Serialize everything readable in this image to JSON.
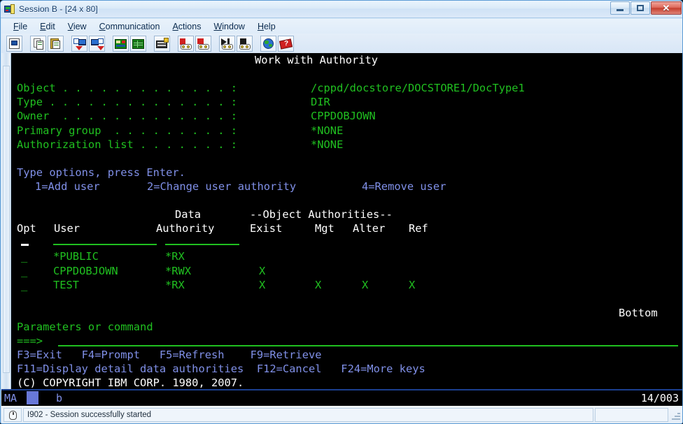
{
  "window": {
    "title": "Session B - [24 x 80]",
    "icon": "session-icon",
    "buttons": {
      "minimize": "minimize-button",
      "maximize": "maximize-button",
      "close": "✕"
    }
  },
  "menubar": {
    "items": [
      {
        "label": "File",
        "acc": "F",
        "rest": "ile"
      },
      {
        "label": "Edit",
        "acc": "E",
        "rest": "dit"
      },
      {
        "label": "View",
        "acc": "V",
        "rest": "iew"
      },
      {
        "label": "Communication",
        "acc": "C",
        "rest": "ommunication"
      },
      {
        "label": "Actions",
        "acc": "A",
        "rest": "ctions"
      },
      {
        "label": "Window",
        "acc": "W",
        "rest": "indow"
      },
      {
        "label": "Help",
        "acc": "H",
        "rest": "elp"
      }
    ]
  },
  "toolbar": {
    "buttons": [
      "display-session-icon",
      "copy-icon",
      "paste-icon",
      "send-file-icon",
      "receive-file-icon",
      "display-keypad-icon",
      "spreadsheet-icon",
      "keyboard-remap-icon",
      "record-macro-icon",
      "stop-macro-icon",
      "play-macro-icon",
      "stop-playback-icon",
      "globe-icon",
      "help-index-icon"
    ]
  },
  "terminal": {
    "screen_title": "Work with Authority",
    "fields": [
      {
        "label": "Object . . . . . . . . . . . . . :",
        "value": "/cppd/docstore/DOCSTORE1/DocType1"
      },
      {
        "label": "Type . . . . . . . . . . . . . . :",
        "value": "DIR"
      },
      {
        "label": "Owner  . . . . . . . . . . . . . :",
        "value": "CPPDOBJOWN"
      },
      {
        "label": "Primary group  . . . . . . . . . :",
        "value": "*NONE"
      },
      {
        "label": "Authorization list . . . . . . . :",
        "value": "*NONE"
      }
    ],
    "instructions": {
      "line1": "Type options, press Enter.",
      "options": [
        "1=Add user",
        "2=Change user authority",
        "4=Remove user"
      ]
    },
    "table": {
      "header_top": {
        "data": "Data",
        "object_auth": "--Object Authorities--"
      },
      "header_bottom": {
        "opt": "Opt",
        "user": "User",
        "authority": "Authority",
        "exist": "Exist",
        "mgt": "Mgt",
        "alter": "Alter",
        "ref": "Ref"
      },
      "rows": [
        {
          "opt": "_",
          "user": "*PUBLIC",
          "authority": "*RX",
          "exist": "",
          "mgt": "",
          "alter": "",
          "ref": ""
        },
        {
          "opt": "_",
          "user": "CPPDOBJOWN",
          "authority": "*RWX",
          "exist": "X",
          "mgt": "",
          "alter": "",
          "ref": ""
        },
        {
          "opt": "_",
          "user": "TEST",
          "authority": "*RX",
          "exist": "X",
          "mgt": "X",
          "alter": "X",
          "ref": "X"
        }
      ]
    },
    "more_indicator": "Bottom",
    "command": {
      "label": "Parameters or command",
      "prompt": "===>",
      "value": ""
    },
    "fkeys_line1": "F3=Exit   F4=Prompt   F5=Refresh    F9=Retrieve",
    "fkeys_line2": "F11=Display detail data authorities  F12=Cancel   F24=More keys",
    "copyright": "(C) COPYRIGHT IBM CORP. 1980, 2007."
  },
  "oia": {
    "indicator": "MA",
    "input_inhibit": "",
    "session_letter": "b",
    "cursor_position": "14/003"
  },
  "statusbar": {
    "icon": "mouse-icon",
    "message": "I902 - Session successfully started"
  },
  "colors": {
    "green": "#20c020",
    "white": "#ffffff",
    "blue": "#8090e8",
    "background": "#000000"
  }
}
